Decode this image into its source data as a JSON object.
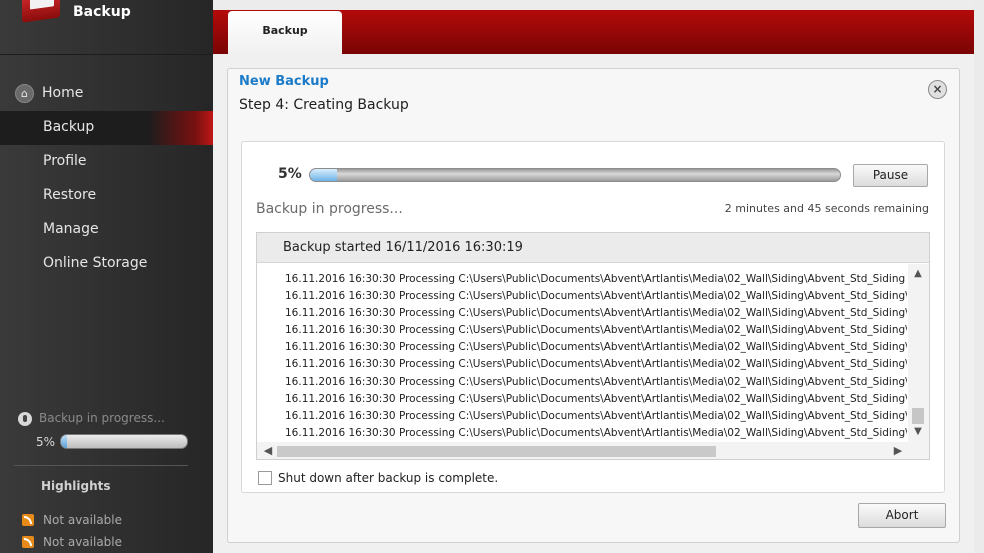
{
  "app": {
    "title": "Backup"
  },
  "sidebar": {
    "items": [
      {
        "label": "Home"
      },
      {
        "label": "Backup"
      },
      {
        "label": "Profile"
      },
      {
        "label": "Restore"
      },
      {
        "label": "Manage"
      },
      {
        "label": "Online Storage"
      }
    ],
    "status": {
      "text": "Backup in progress...",
      "percent_label": "5%",
      "progress": 0.05
    },
    "highlights": {
      "title": "Highlights",
      "items": [
        "Not available",
        "Not available"
      ]
    }
  },
  "tabs": [
    {
      "label": "Backup"
    }
  ],
  "main": {
    "title": "New Backup",
    "step": "Step 4: Creating Backup",
    "close_symbol": "×",
    "progress": {
      "percent_label": "5%",
      "value": 0.05,
      "status_text": "Backup in progress...",
      "remaining_text": "2 minutes and 45 seconds remaining",
      "pause_label": "Pause"
    },
    "log": {
      "header": "Backup started 16/11/2016 16:30:19",
      "lines": [
        "16.11.2016 16:30:30 Processing C:\\Users\\Public\\Documents\\Abvent\\Artlantis\\Media\\02_Wall\\Siding\\Abvent_Std_Siding",
        "16.11.2016 16:30:30 Processing C:\\Users\\Public\\Documents\\Abvent\\Artlantis\\Media\\02_Wall\\Siding\\Abvent_Std_Siding\\AV_Wall_",
        "16.11.2016 16:30:30 Processing C:\\Users\\Public\\Documents\\Abvent\\Artlantis\\Media\\02_Wall\\Siding\\Abvent_Std_Siding\\AV_Wall_",
        "16.11.2016 16:30:30 Processing C:\\Users\\Public\\Documents\\Abvent\\Artlantis\\Media\\02_Wall\\Siding\\Abvent_Std_Siding\\AV_Wall_",
        "16.11.2016 16:30:30 Processing C:\\Users\\Public\\Documents\\Abvent\\Artlantis\\Media\\02_Wall\\Siding\\Abvent_Std_Siding\\AV_Wall_",
        "16.11.2016 16:30:30 Processing C:\\Users\\Public\\Documents\\Abvent\\Artlantis\\Media\\02_Wall\\Siding\\Abvent_Std_Siding\\AV_Wall_",
        "16.11.2016 16:30:30 Processing C:\\Users\\Public\\Documents\\Abvent\\Artlantis\\Media\\02_Wall\\Siding\\Abvent_Std_Siding\\AV_Wall_",
        "16.11.2016 16:30:30 Processing C:\\Users\\Public\\Documents\\Abvent\\Artlantis\\Media\\02_Wall\\Siding\\Abvent_Std_Siding\\Planches_",
        "16.11.2016 16:30:30 Processing C:\\Users\\Public\\Documents\\Abvent\\Artlantis\\Media\\02_Wall\\Siding\\Abvent_Std_Siding\\Planches_",
        "16.11.2016 16:30:30 Processing C:\\Users\\Public\\Documents\\Abvent\\Artlantis\\Media\\02_Wall\\Siding\\Abvent_Std_Siding\\Planches_"
      ]
    },
    "shutdown_label": "Shut down after backup is complete.",
    "shutdown_checked": false,
    "abort_label": "Abort"
  },
  "icons": {
    "home": "home-icon",
    "close": "close-icon",
    "status": "microphone-icon",
    "highlight": "rss-icon",
    "scroll_up": "▲",
    "scroll_down": "▼",
    "scroll_left": "◀",
    "scroll_right": "▶"
  },
  "colors": {
    "brand_red": "#9a0808",
    "accent_blue": "#1a7bc9",
    "progress_blue": "#6fb4e8"
  }
}
